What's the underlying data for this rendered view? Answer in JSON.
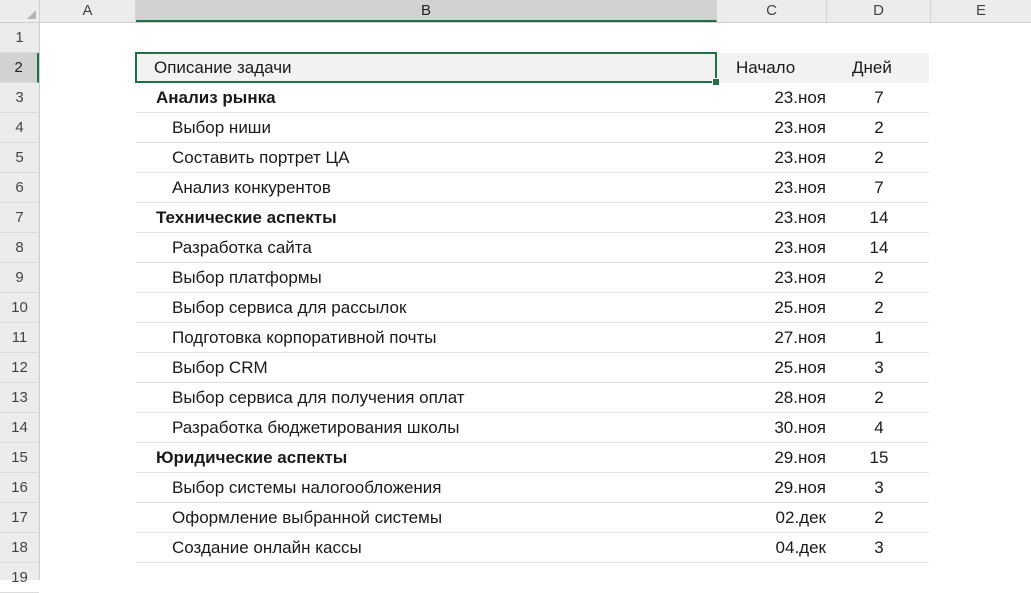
{
  "columns": [
    "A",
    "B",
    "C",
    "D",
    "E"
  ],
  "row_numbers": [
    "1",
    "2",
    "3",
    "4",
    "5",
    "6",
    "7",
    "8",
    "9",
    "10",
    "11",
    "12",
    "13",
    "14",
    "15",
    "16",
    "17",
    "18",
    "19"
  ],
  "header": {
    "task": "Описание задачи",
    "start": "Начало",
    "days": "Дней"
  },
  "rows": [
    {
      "task": "Анализ рынка",
      "start": "23.ноя",
      "days": "7",
      "bold": true
    },
    {
      "task": "Выбор ниши",
      "start": "23.ноя",
      "days": "2",
      "bold": false
    },
    {
      "task": "Составить портрет ЦА",
      "start": "23.ноя",
      "days": "2",
      "bold": false
    },
    {
      "task": "Анализ конкурентов",
      "start": "23.ноя",
      "days": "7",
      "bold": false
    },
    {
      "task": "Технические аспекты",
      "start": "23.ноя",
      "days": "14",
      "bold": true
    },
    {
      "task": "Разработка сайта",
      "start": "23.ноя",
      "days": "14",
      "bold": false
    },
    {
      "task": "Выбор платформы",
      "start": "23.ноя",
      "days": "2",
      "bold": false
    },
    {
      "task": "Выбор сервиса для рассылок",
      "start": "25.ноя",
      "days": "2",
      "bold": false
    },
    {
      "task": "Подготовка корпоративной почты",
      "start": "27.ноя",
      "days": "1",
      "bold": false
    },
    {
      "task": "Выбор CRM",
      "start": "25.ноя",
      "days": "3",
      "bold": false
    },
    {
      "task": "Выбор сервиса для получения оплат",
      "start": "28.ноя",
      "days": "2",
      "bold": false
    },
    {
      "task": "Разработка бюджетирования школы",
      "start": "30.ноя",
      "days": "4",
      "bold": false
    },
    {
      "task": "Юридические аспекты",
      "start": "29.ноя",
      "days": "15",
      "bold": true
    },
    {
      "task": "Выбор системы налогообложения",
      "start": "29.ноя",
      "days": "3",
      "bold": false
    },
    {
      "task": "Оформление выбранной системы",
      "start": "02.дек",
      "days": "2",
      "bold": false
    },
    {
      "task": "Создание онлайн кассы",
      "start": "04.дек",
      "days": "3",
      "bold": false
    }
  ],
  "colors": {
    "selection": "#1e7145",
    "header_bg": "#ececec",
    "table_header_bg": "#f2f2f2"
  }
}
